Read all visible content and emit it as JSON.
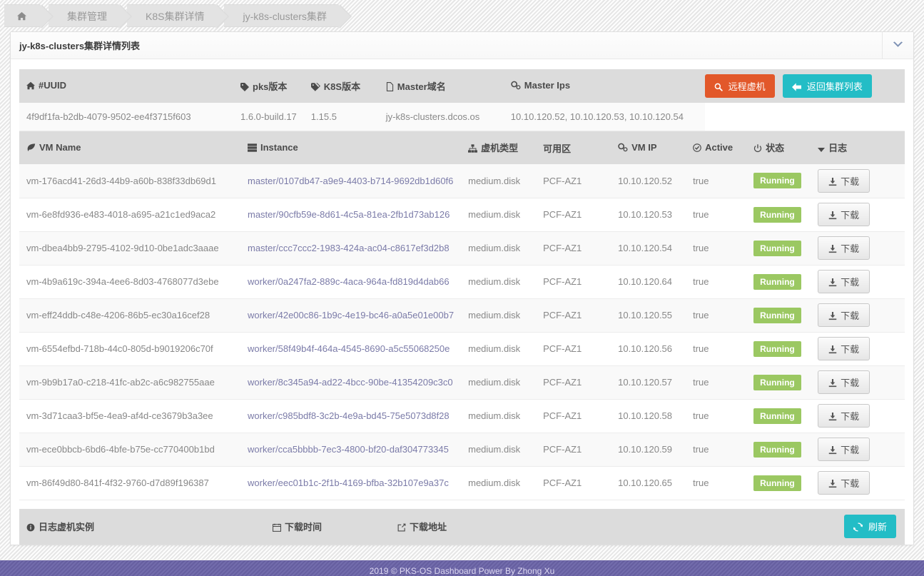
{
  "breadcrumb": {
    "home_icon": "home-icon",
    "items": [
      {
        "label": "集群管理"
      },
      {
        "label": "K8S集群详情"
      },
      {
        "label": "jy-k8s-clusters集群"
      }
    ]
  },
  "panel": {
    "title": "jy-k8s-clusters集群详情列表",
    "collapse_icon": "chevron-down-icon"
  },
  "cluster_info": {
    "headers": [
      {
        "icon": "home-icon",
        "label": "#UUID"
      },
      {
        "icon": "tag-icon",
        "label": "pks版本"
      },
      {
        "icon": "tags-icon",
        "label": "K8S版本"
      },
      {
        "icon": "file-icon",
        "label": "Master域名"
      },
      {
        "icon": "cogs-icon",
        "label": "Master Ips"
      }
    ],
    "row": {
      "uuid": "4f9df1fa-b2db-4079-9502-ee4f3715f603",
      "pks_version": "1.6.0-build.17",
      "k8s_version": "1.15.5",
      "master_domain": "jy-k8s-clusters.dcos.os",
      "master_ips": "10.10.120.52, 10.10.120.53, 10.10.120.54"
    },
    "actions": {
      "remote_vm": {
        "label": "远程虚机",
        "icon": "search-icon",
        "color": "#e2582a"
      },
      "back_to_list": {
        "label": "返回集群列表",
        "icon": "arrow-left-icon",
        "color": "#23bdc6"
      }
    }
  },
  "vm_table": {
    "headers": [
      {
        "icon": "leaf-icon",
        "label": "VM Name"
      },
      {
        "icon": "server-icon",
        "label": "Instance"
      },
      {
        "icon": "sitemap-icon",
        "label": "虚机类型"
      },
      {
        "icon": "",
        "label": "可用区"
      },
      {
        "icon": "cogs-icon",
        "label": "VM IP"
      },
      {
        "icon": "check-circle-icon",
        "label": "Active"
      },
      {
        "icon": "power-icon",
        "label": "状态"
      },
      {
        "icon": "caret-down-icon",
        "label": "日志"
      }
    ],
    "download_label": "下载",
    "download_icon": "download-icon",
    "rows": [
      {
        "vm_name": "vm-176acd41-26d3-44b9-a60b-838f33db69d1",
        "instance": "master/0107db47-a9e9-4403-b714-9692db1d60f6",
        "vm_type": "medium.disk",
        "az": "PCF-AZ1",
        "vm_ip": "10.10.120.52",
        "active": "true",
        "status": "Running"
      },
      {
        "vm_name": "vm-6e8fd936-e483-4018-a695-a21c1ed9aca2",
        "instance": "master/90cfb59e-8d61-4c5a-81ea-2fb1d73ab126",
        "vm_type": "medium.disk",
        "az": "PCF-AZ1",
        "vm_ip": "10.10.120.53",
        "active": "true",
        "status": "Running"
      },
      {
        "vm_name": "vm-dbea4bb9-2795-4102-9d10-0be1adc3aaae",
        "instance": "master/ccc7ccc2-1983-424a-ac04-c8617ef3d2b8",
        "vm_type": "medium.disk",
        "az": "PCF-AZ1",
        "vm_ip": "10.10.120.54",
        "active": "true",
        "status": "Running"
      },
      {
        "vm_name": "vm-4b9a619c-394a-4ee6-8d03-4768077d3ebe",
        "instance": "worker/0a247fa2-889c-4aca-964a-fd819d4dab66",
        "vm_type": "medium.disk",
        "az": "PCF-AZ1",
        "vm_ip": "10.10.120.64",
        "active": "true",
        "status": "Running"
      },
      {
        "vm_name": "vm-eff24ddb-c48e-4206-86b5-ec30a16cef28",
        "instance": "worker/42e00c86-1b9c-4e19-bc46-a0a5e01e00b7",
        "vm_type": "medium.disk",
        "az": "PCF-AZ1",
        "vm_ip": "10.10.120.55",
        "active": "true",
        "status": "Running"
      },
      {
        "vm_name": "vm-6554efbd-718b-44c0-805d-b9019206c70f",
        "instance": "worker/58f49b4f-464a-4545-8690-a5c55068250e",
        "vm_type": "medium.disk",
        "az": "PCF-AZ1",
        "vm_ip": "10.10.120.56",
        "active": "true",
        "status": "Running"
      },
      {
        "vm_name": "vm-9b9b17a0-c218-41fc-ab2c-a6c982755aae",
        "instance": "worker/8c345a94-ad22-4bcc-90be-41354209c3c0",
        "vm_type": "medium.disk",
        "az": "PCF-AZ1",
        "vm_ip": "10.10.120.57",
        "active": "true",
        "status": "Running"
      },
      {
        "vm_name": "vm-3d71caa3-bf5e-4ea9-af4d-ce3679b3a3ee",
        "instance": "worker/c985bdf8-3c2b-4e9a-bd45-75e5073d8f28",
        "vm_type": "medium.disk",
        "az": "PCF-AZ1",
        "vm_ip": "10.10.120.58",
        "active": "true",
        "status": "Running"
      },
      {
        "vm_name": "vm-ece0bbcb-6bd6-4bfe-b75e-cc770400b1bd",
        "instance": "worker/cca5bbbb-7ec3-4800-bf20-daf304773345",
        "vm_type": "medium.disk",
        "az": "PCF-AZ1",
        "vm_ip": "10.10.120.59",
        "active": "true",
        "status": "Running"
      },
      {
        "vm_name": "vm-86f49d80-841f-4f32-9760-d7d89f196387",
        "instance": "worker/eec01b1c-2f1b-4169-bfba-32b107e9a37c",
        "vm_type": "medium.disk",
        "az": "PCF-AZ1",
        "vm_ip": "10.10.120.65",
        "active": "true",
        "status": "Running"
      }
    ]
  },
  "log_table": {
    "headers": [
      {
        "icon": "info-circle-icon",
        "label": "日志虚机实例"
      },
      {
        "icon": "calendar-icon",
        "label": "下载时间"
      },
      {
        "icon": "external-link-icon",
        "label": "下载地址"
      }
    ],
    "refresh": {
      "label": "刷新",
      "icon": "refresh-icon",
      "color": "#23bdc6"
    }
  },
  "footer": {
    "text": "2019 © PKS-OS Dashboard Power By Zhong Xu"
  }
}
